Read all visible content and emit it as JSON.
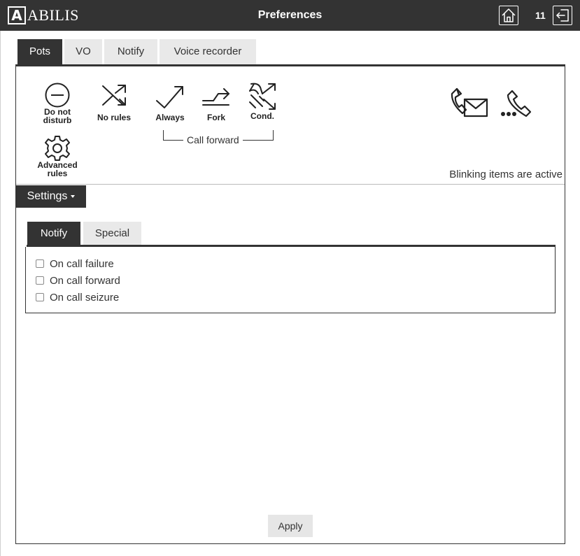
{
  "header": {
    "logo_letter": "A",
    "logo_text": "ABILIS",
    "title": "Preferences",
    "user_number": "11",
    "home_icon": "home-icon",
    "logout_icon": "logout-icon"
  },
  "main_tabs": [
    {
      "label": "Pots",
      "active": true
    },
    {
      "label": "VO",
      "active": false
    },
    {
      "label": "Notify",
      "active": false
    },
    {
      "label": "Voice recorder",
      "active": false
    }
  ],
  "quick_actions": {
    "do_not_disturb": {
      "label": "Do not disturb",
      "icon": "minus-circle-icon"
    },
    "no_rules": {
      "label": "No rules",
      "icon": "shuffle-icon"
    },
    "always": {
      "label": "Always",
      "icon": "arrow-up-right-icon"
    },
    "fork": {
      "label": "Fork",
      "icon": "fork-arrow-icon"
    },
    "cond": {
      "label": "Cond.",
      "icon": "conditional-arrows-icon"
    },
    "advanced_rules": {
      "label": "Advanced rules",
      "icon": "gear-icon"
    },
    "call_forward_group": "Call forward",
    "voicemail_icon": "phone-mail-icon",
    "call_waiting_icon": "phone-dots-icon"
  },
  "blink_note": "Blinking items are active",
  "settings": {
    "label": "Settings",
    "icon": "caret-down-icon"
  },
  "sub_tabs": [
    {
      "label": "Notify",
      "active": true
    },
    {
      "label": "Special",
      "active": false
    }
  ],
  "notify_options": [
    {
      "label": "On call failure",
      "checked": false
    },
    {
      "label": "On call forward",
      "checked": false
    },
    {
      "label": "On call seizure",
      "checked": false
    }
  ],
  "apply_label": "Apply",
  "colors": {
    "dark": "#333333",
    "tab_inactive": "#e9e9e9",
    "apply_bg": "#e6e6e6"
  }
}
